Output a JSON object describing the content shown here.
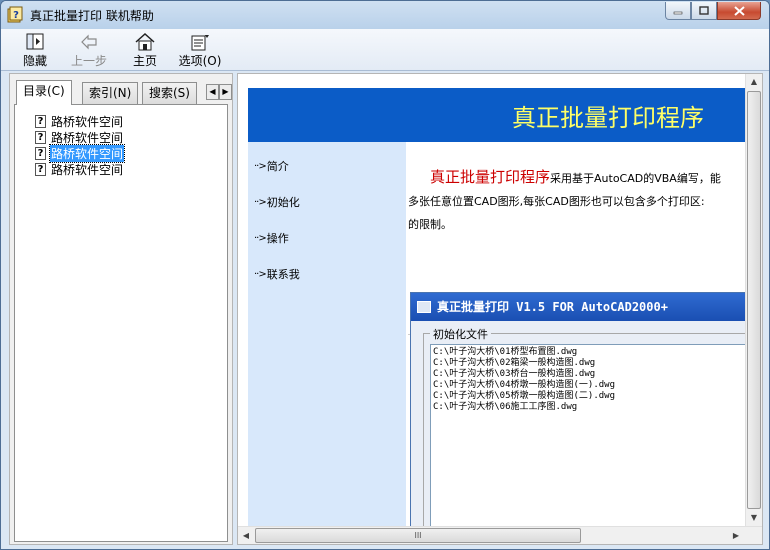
{
  "window": {
    "title": "真正批量打印 联机帮助",
    "caption_min": "–",
    "caption_max": "□",
    "caption_close": "✕"
  },
  "toolbar": {
    "hide_label": "隐藏",
    "back_label": "上一步",
    "home_label": "主页",
    "options_label": "选项(O)"
  },
  "left": {
    "tabs": [
      "目录(C)",
      "索引(N)",
      "搜索(S)"
    ],
    "tab_prev": "◀",
    "tab_next": "▶",
    "tree_items": [
      "路桥软件空间",
      "路桥软件空间",
      "路桥软件空间",
      "路桥软件空间"
    ],
    "selected_index": 2
  },
  "content": {
    "banner_title": "真正批量打印程序",
    "nav": [
      "简介",
      "初始化",
      "操作",
      "联系我"
    ],
    "nav_arrow": "··>",
    "intro_head": "真正批量打印程序",
    "intro_line1": "采用基于AutoCAD的VBA编写，能",
    "intro_line2": "多张任意位置CAD图形,每张CAD图形也可以包含多个打印区:",
    "intro_line3": "的限制。",
    "app_title": "真正批量打印 V1.5 FOR AutoCAD2000+",
    "group_label": "初始化文件",
    "files": [
      "C:\\叶子沟大桥\\01桥型布置图.dwg",
      "C:\\叶子沟大桥\\02箱梁一般构造图.dwg",
      "C:\\叶子沟大桥\\03桥台一般构造图.dwg",
      "C:\\叶子沟大桥\\04桥墩一般构造图(一).dwg",
      "C:\\叶子沟大桥\\05桥墩一般构造图(二).dwg",
      "C:\\叶子沟大桥\\06施工工序图.dwg"
    ]
  },
  "scroll": {
    "up": "▲",
    "down": "▼",
    "left": "◀",
    "right": "▶",
    "grip": "III"
  }
}
